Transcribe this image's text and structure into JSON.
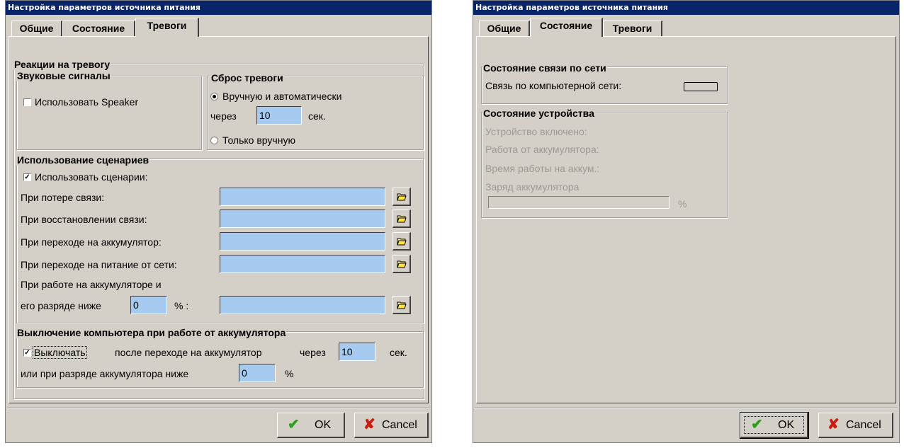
{
  "window_title": "Настройка параметров источника питания",
  "tabs": {
    "general": "Общие",
    "status": "Состояние",
    "alarms": "Тревоги"
  },
  "alarms": {
    "group_reactions": "Реакции на тревогу",
    "sound": {
      "title": "Звуковые сигналы",
      "use_speaker": "Использовать Speaker",
      "use_speaker_checked": false
    },
    "reset": {
      "title": "Сброс тревоги",
      "manual_auto": "Вручную и автоматически",
      "after": "через",
      "seconds_value": "10",
      "sec_unit": "сек.",
      "manual_only": "Только вручную",
      "selected": "manual_auto"
    },
    "scenarios": {
      "title": "Использование сценариев",
      "use_scenarios": "Использовать сценарии:",
      "use_scenarios_checked": true,
      "rows": [
        {
          "label": "При потере связи:",
          "value": ""
        },
        {
          "label": "При восстановлении связи:",
          "value": ""
        },
        {
          "label": "При переходе на аккумулятор:",
          "value": ""
        },
        {
          "label": "При переходе на питание от сети:",
          "value": ""
        }
      ],
      "battery_line1": "При работе на аккумуляторе и",
      "battery_line2": "его разряде ниже",
      "battery_percent_value": "0",
      "percent_colon": "% :",
      "battery_script_value": ""
    },
    "shutdown": {
      "title": "Выключение компьютера при работе от аккумулятора",
      "turn_off": "Выключать",
      "turn_off_checked": true,
      "after_switch": "после переходе на аккумулятор",
      "after": "через",
      "seconds_value": "10",
      "sec_unit": "сек.",
      "or_discharge": "или при разряде аккумулятора ниже",
      "percent_value": "0",
      "percent_unit": "%"
    }
  },
  "status": {
    "network": {
      "title": "Состояние связи по сети",
      "label": "Связь по компьютерной сети:"
    },
    "device": {
      "title": "Состояние устройства",
      "device_on": "Устройство включено:",
      "on_battery": "Работа от аккумулятора:",
      "battery_time": "Время работы на аккум.:",
      "battery_charge": "Заряд аккумулятора",
      "battery_charge_percent": 0,
      "percent_unit": "%"
    }
  },
  "buttons": {
    "ok": "OK",
    "cancel": "Cancel"
  },
  "icons": {
    "ok": "check-icon",
    "cancel": "cross-icon",
    "browse": "folder-open-icon"
  },
  "colors": {
    "title_bar": "#0a246a",
    "dialog": "#d4d0c8",
    "field": "#a6caf0",
    "ok_check": "#2e9e1f",
    "cancel_x": "#cc1c10"
  }
}
